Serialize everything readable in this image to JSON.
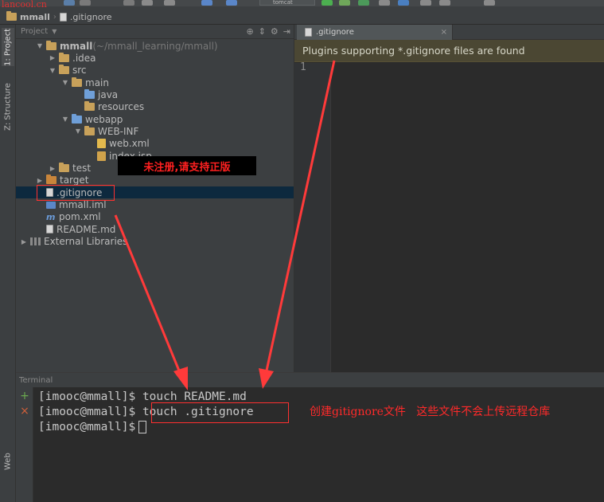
{
  "watermark": {
    "site": "lancool.cn"
  },
  "navbar": {
    "crumbs": [
      {
        "label": "mmall",
        "type": "folder"
      },
      {
        "label": ".gitignore",
        "type": "file"
      }
    ],
    "run_config": "tomcat"
  },
  "tool_tabs": {
    "project": "1: Project",
    "structure": "Z: Structure",
    "web": "Web"
  },
  "project_panel": {
    "title": "Project",
    "tree": [
      {
        "label": "mmall",
        "suffix": " (~/mmall_learning/mmall)",
        "icon": "folder",
        "arrow": "down"
      },
      {
        "label": ".idea",
        "icon": "folder",
        "arrow": "right"
      },
      {
        "label": "src",
        "icon": "folder",
        "arrow": "down"
      },
      {
        "label": "main",
        "icon": "folder",
        "arrow": "down"
      },
      {
        "label": "java",
        "icon": "folder-blue",
        "arrow": ""
      },
      {
        "label": "resources",
        "icon": "folder",
        "arrow": ""
      },
      {
        "label": "webapp",
        "icon": "folder-blue",
        "arrow": "down"
      },
      {
        "label": "WEB-INF",
        "icon": "folder",
        "arrow": "down"
      },
      {
        "label": "web.xml",
        "icon": "xml",
        "arrow": ""
      },
      {
        "label": "index.jsp",
        "icon": "jsp",
        "arrow": ""
      },
      {
        "label": "test",
        "icon": "folder",
        "arrow": "right"
      },
      {
        "label": "target",
        "icon": "folder-orange",
        "arrow": "right"
      },
      {
        "label": ".gitignore",
        "icon": "file",
        "arrow": ""
      },
      {
        "label": "mmall.iml",
        "icon": "iml",
        "arrow": ""
      },
      {
        "label": "pom.xml",
        "icon": "m",
        "arrow": ""
      },
      {
        "label": "README.md",
        "icon": "file",
        "arrow": ""
      },
      {
        "label": "External Libraries",
        "icon": "libs",
        "arrow": "right"
      }
    ]
  },
  "banner": {
    "text": "未注册,请支持正版"
  },
  "editor": {
    "tab_label": ".gitignore",
    "tab_close": "×",
    "plugin_notice": "Plugins supporting *.gitignore files are found",
    "line_numbers": [
      "1"
    ]
  },
  "terminal": {
    "title": "Terminal",
    "add_icon": "+",
    "close_icon": "×",
    "lines": [
      "[imooc@mmall]$ touch README.md",
      "[imooc@mmall]$ touch .gitignore",
      "[imooc@mmall]$"
    ]
  },
  "annotation": {
    "text": "创建gitignore文件   这些文件不会上传远程仓库"
  },
  "colors": {
    "highlight": "#ff3030",
    "selection": "#0d293e",
    "notice": "#4b4733"
  }
}
